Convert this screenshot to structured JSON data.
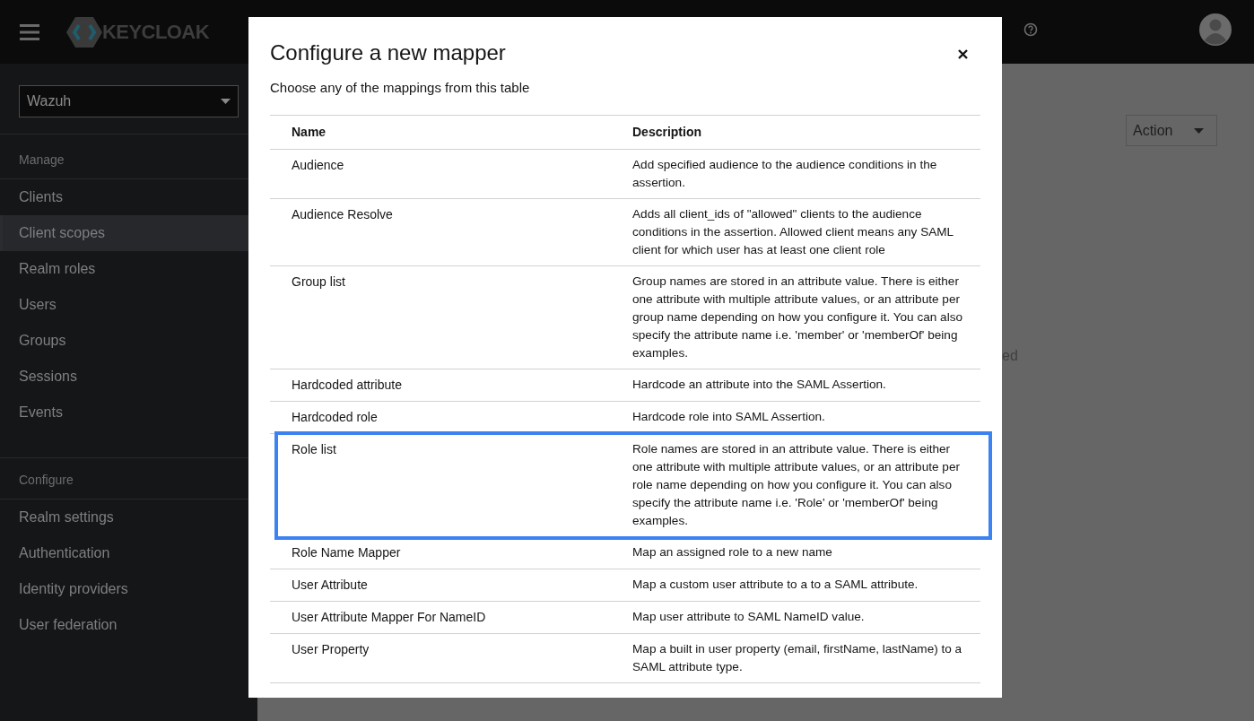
{
  "header": {
    "logo": "KEYCLOAK"
  },
  "sidebar": {
    "realm": "Wazuh",
    "sections": [
      {
        "title": "Manage",
        "items": [
          {
            "label": "Clients",
            "selected": false
          },
          {
            "label": "Client scopes",
            "selected": true
          },
          {
            "label": "Realm roles",
            "selected": false
          },
          {
            "label": "Users",
            "selected": false
          },
          {
            "label": "Groups",
            "selected": false
          },
          {
            "label": "Sessions",
            "selected": false
          },
          {
            "label": "Events",
            "selected": false
          }
        ]
      },
      {
        "title": "Configure",
        "items": [
          {
            "label": "Realm settings",
            "selected": false
          },
          {
            "label": "Authentication",
            "selected": false
          },
          {
            "label": "Identity providers",
            "selected": false
          },
          {
            "label": "User federation",
            "selected": false
          }
        ]
      }
    ]
  },
  "main": {
    "action_button": "Action",
    "partial_text": "ed"
  },
  "modal": {
    "title": "Configure a new mapper",
    "subtitle": "Choose any of the mappings from this table",
    "columns": [
      "Name",
      "Description"
    ],
    "rows": [
      {
        "name": "Audience",
        "description": "Add specified audience to the audience conditions in the assertion.",
        "selected": false
      },
      {
        "name": "Audience Resolve",
        "description": "Adds all client_ids of \"allowed\" clients to the audience conditions in the assertion. Allowed client means any SAML client for which user has at least one client role",
        "selected": false
      },
      {
        "name": "Group list",
        "description": "Group names are stored in an attribute value. There is either one attribute with multiple attribute values, or an attribute per group name depending on how you configure it. You can also specify the attribute name i.e. 'member' or 'memberOf' being examples.",
        "selected": false
      },
      {
        "name": "Hardcoded attribute",
        "description": "Hardcode an attribute into the SAML Assertion.",
        "selected": false
      },
      {
        "name": "Hardcoded role",
        "description": "Hardcode role into SAML Assertion.",
        "selected": false
      },
      {
        "name": "Role list",
        "description": "Role names are stored in an attribute value. There is either one attribute with multiple attribute values, or an attribute per role name depending on how you configure it. You can also specify the attribute name i.e. 'Role' or 'memberOf' being examples.",
        "selected": true
      },
      {
        "name": "Role Name Mapper",
        "description": "Map an assigned role to a new name",
        "selected": false
      },
      {
        "name": "User Attribute",
        "description": "Map a custom user attribute to a to a SAML attribute.",
        "selected": false
      },
      {
        "name": "User Attribute Mapper For NameID",
        "description": "Map user attribute to SAML NameID value.",
        "selected": false
      },
      {
        "name": "User Property",
        "description": "Map a built in user property (email, firstName, lastName) to a SAML attribute type.",
        "selected": false
      }
    ]
  }
}
